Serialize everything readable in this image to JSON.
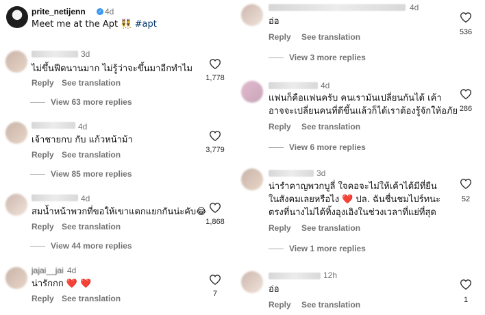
{
  "post": {
    "username": "prite_netijenn",
    "time": "4d",
    "caption": "Meet me at the Apt 👯",
    "hashtag": "#apt"
  },
  "actions": {
    "reply": "Reply",
    "translate": "See translation"
  },
  "left_comments": [
    {
      "time": "3d",
      "text": "ไม่ขึ้นฟีดนานมาก ไม่รู้ว่าจะขึ้นมาอีกทำไม",
      "likes": "1,778",
      "view_more": "View 63 more replies"
    },
    {
      "time": "4d",
      "text": "เจ้าชายกบ กับ แก้วหน้าม้า",
      "likes": "3,779",
      "view_more": "View 85 more replies"
    },
    {
      "time": "4d",
      "text": "สมน้ำหน้าพวกที่ขอให้เขาแตกแยกกันน่ะคับ😂",
      "likes": "1,868",
      "view_more": "View 44 more replies"
    },
    {
      "username": "jajai__jai",
      "time": "4d",
      "text": "น่ารักกก ❤️ ❤️",
      "likes": "7"
    }
  ],
  "right_comments": [
    {
      "time": "4d",
      "text": "อ่อ",
      "likes": "536",
      "view_more": "View 3 more replies"
    },
    {
      "time": "4d",
      "text_lines": [
        "แฟนก็คือแฟนครับ คนเรามันเปลี่ยนกันได้ เค้า",
        "อาจจะเปลี่ยนคนที่ดีขึ้นแล้วก็ได้เราต้องรู้จักให้อภัย"
      ],
      "likes": "286",
      "view_more": "View 6 more replies"
    },
    {
      "time": "3d",
      "text_lines": [
        "น่ารำคาญพวกบูลี่ ใจคอจะไม่ให้เค้าได้มีที่ยืน",
        "ในสังคมเลยหรือไง ❤️ ปล. ฉันชื่นชมไปร์ทนะ",
        "ตรงที่นางไม่ได้ทิ้งอุงเอิงในช่วงเวลาที่แย่ที่สุด"
      ],
      "likes": "52",
      "view_more": "View 1 more replies"
    },
    {
      "time": "12h",
      "text": "อ่อ",
      "likes": "1"
    }
  ]
}
